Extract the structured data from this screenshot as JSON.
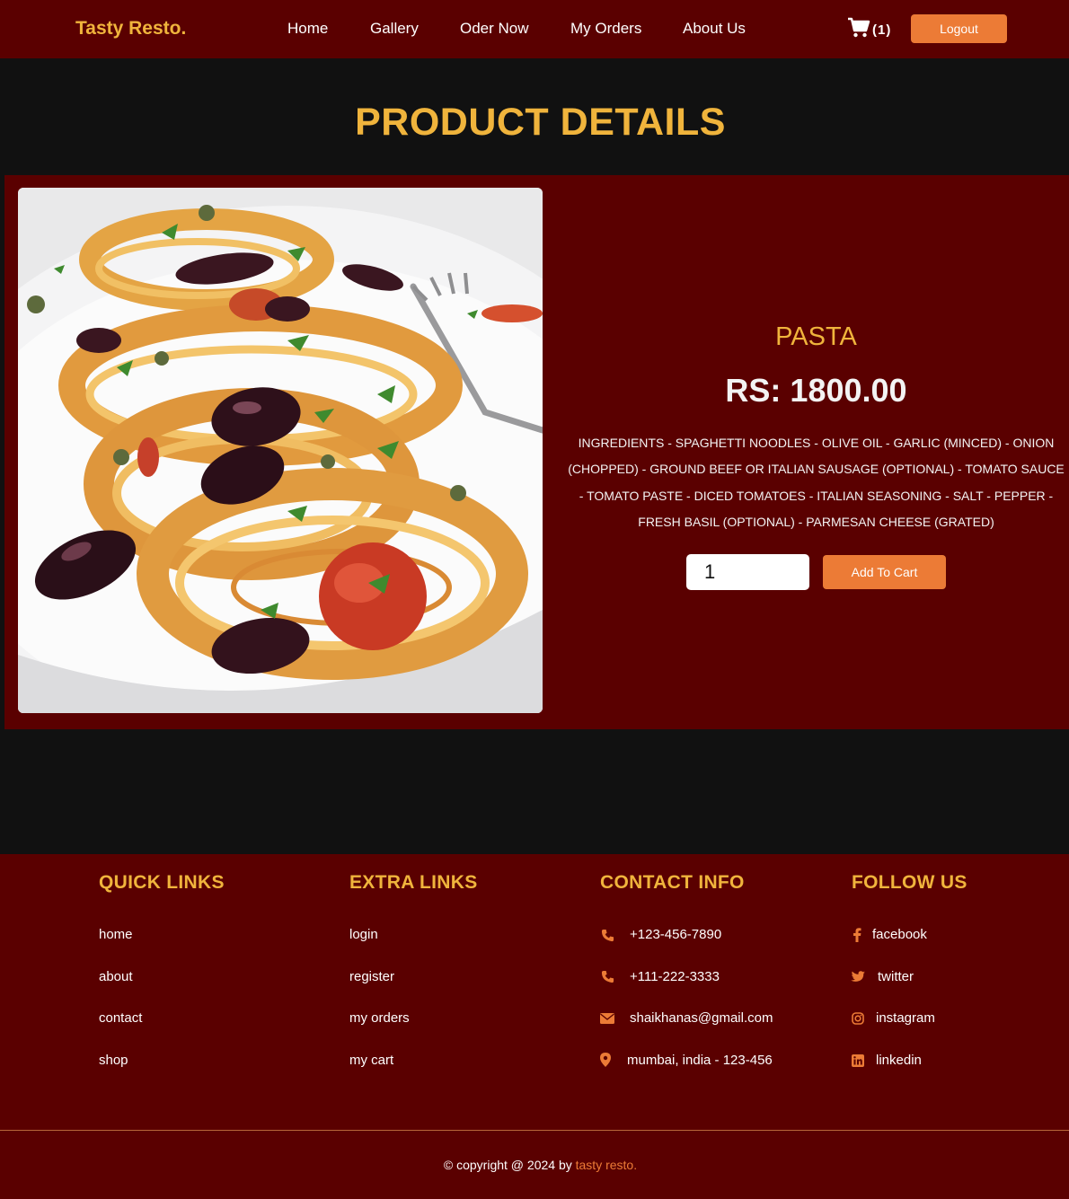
{
  "header": {
    "logo": "Tasty Resto.",
    "nav": [
      "Home",
      "Gallery",
      "Oder Now",
      "My Orders",
      "About Us"
    ],
    "cart_count": "(1)",
    "logout": "Logout"
  },
  "page_title": "PRODUCT DETAILS",
  "product": {
    "name": "PASTA",
    "price": "RS: 1800.00",
    "ingredients": "INGREDIENTS - SPAGHETTI NOODLES - OLIVE OIL - GARLIC (MINCED) - ONION (CHOPPED) - GROUND BEEF OR ITALIAN SAUSAGE (OPTIONAL) - TOMATO SAUCE - TOMATO PASTE - DICED TOMATOES - ITALIAN SEASONING - SALT - PEPPER - FRESH BASIL (OPTIONAL) - PARMESAN CHEESE (GRATED)",
    "quantity": "1",
    "add_to_cart": "Add To Cart"
  },
  "footer": {
    "quick_links": {
      "title": "QUICK LINKS",
      "items": [
        "home",
        "about",
        "contact",
        "shop"
      ]
    },
    "extra_links": {
      "title": "EXTRA LINKS",
      "items": [
        "login",
        "register",
        "my orders",
        "my cart"
      ]
    },
    "contact_info": {
      "title": "CONTACT INFO",
      "items": [
        "+123-456-7890",
        "+111-222-3333",
        "shaikhanas@gmail.com",
        "mumbai, india - 123-456"
      ]
    },
    "follow_us": {
      "title": "FOLLOW US",
      "items": [
        "facebook",
        "twitter",
        "instagram",
        "linkedin"
      ]
    },
    "copyright_prefix": "© copyright @ 2024 by",
    "copyright_brand": "tasty resto."
  },
  "colors": {
    "maroon": "#5a0000",
    "gold": "#f0b43c",
    "orange": "#ec7b36",
    "background": "#111111"
  }
}
